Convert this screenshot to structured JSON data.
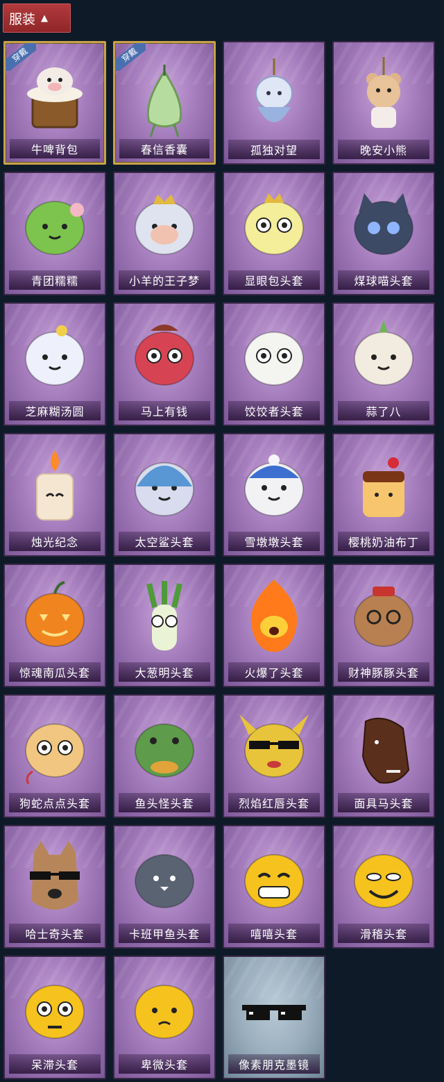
{
  "header": {
    "title": "服装",
    "toggle_icon": "chevron-up-icon"
  },
  "colors": {
    "header": "#a43033",
    "card": "#a57dbd",
    "equipped_border": "#c8a24a",
    "badge": "#4a6fae",
    "background": "#0e1a28"
  },
  "badge_label": "穿戴",
  "items": [
    {
      "label": "牛啤背包",
      "equipped": true,
      "icon": "cow-beer-barrel-backpack-icon"
    },
    {
      "label": "春信香囊",
      "equipped": true,
      "icon": "green-sachet-icon"
    },
    {
      "label": "孤独对望",
      "equipped": false,
      "icon": "girl-keychain-icon"
    },
    {
      "label": "晚安小熊",
      "equipped": false,
      "icon": "teddy-bear-keychain-icon"
    },
    {
      "label": "青团糯糯",
      "equipped": false,
      "icon": "green-dumpling-icon"
    },
    {
      "label": "小羊的王子梦",
      "equipped": false,
      "icon": "sheep-crown-icon"
    },
    {
      "label": "显眼包头套",
      "equipped": false,
      "icon": "lightbulb-crown-icon"
    },
    {
      "label": "煤球喵头套",
      "equipped": false,
      "icon": "black-cat-icon"
    },
    {
      "label": "芝麻糊汤圆",
      "equipped": false,
      "icon": "rice-ball-flower-icon"
    },
    {
      "label": "马上有钱",
      "equipped": false,
      "icon": "red-horse-icon"
    },
    {
      "label": "饺饺者头套",
      "equipped": false,
      "icon": "dumpling-head-icon"
    },
    {
      "label": "蒜了八",
      "equipped": false,
      "icon": "garlic-icon"
    },
    {
      "label": "烛光纪念",
      "equipped": false,
      "icon": "candle-icon"
    },
    {
      "label": "太空鲨头套",
      "equipped": false,
      "icon": "space-shark-icon"
    },
    {
      "label": "雪墩墩头套",
      "equipped": false,
      "icon": "snowman-reindeer-icon"
    },
    {
      "label": "樱桃奶油布丁",
      "equipped": false,
      "icon": "cherry-pudding-icon"
    },
    {
      "label": "惊魂南瓜头套",
      "equipped": false,
      "icon": "pumpkin-icon"
    },
    {
      "label": "大葱明头套",
      "equipped": false,
      "icon": "green-onion-icon"
    },
    {
      "label": "火爆了头套",
      "equipped": false,
      "icon": "fire-spirit-icon"
    },
    {
      "label": "财神豚豚头套",
      "equipped": false,
      "icon": "capybara-fortune-icon"
    },
    {
      "label": "狗蛇点点头套",
      "equipped": false,
      "icon": "dog-snake-icon"
    },
    {
      "label": "鱼头怪头套",
      "equipped": false,
      "icon": "fish-head-icon"
    },
    {
      "label": "烈焰红唇头套",
      "equipped": false,
      "icon": "yellow-mascot-sunglasses-icon"
    },
    {
      "label": "面具马头套",
      "equipped": false,
      "icon": "horse-mask-icon"
    },
    {
      "label": "哈士奇头套",
      "equipped": false,
      "icon": "husky-sunglasses-icon"
    },
    {
      "label": "卡班甲鱼头套",
      "equipped": false,
      "icon": "fish-ball-icon"
    },
    {
      "label": "嘻嘻头套",
      "equipped": false,
      "icon": "grin-emoji-icon"
    },
    {
      "label": "滑稽头套",
      "equipped": false,
      "icon": "funny-emoji-icon"
    },
    {
      "label": "呆滞头套",
      "equipped": false,
      "icon": "stunned-emoji-icon"
    },
    {
      "label": "卑微头套",
      "equipped": false,
      "icon": "humble-emoji-icon"
    },
    {
      "label": "像素朋克墨镜",
      "equipped": false,
      "icon": "pixel-sunglasses-icon"
    }
  ]
}
